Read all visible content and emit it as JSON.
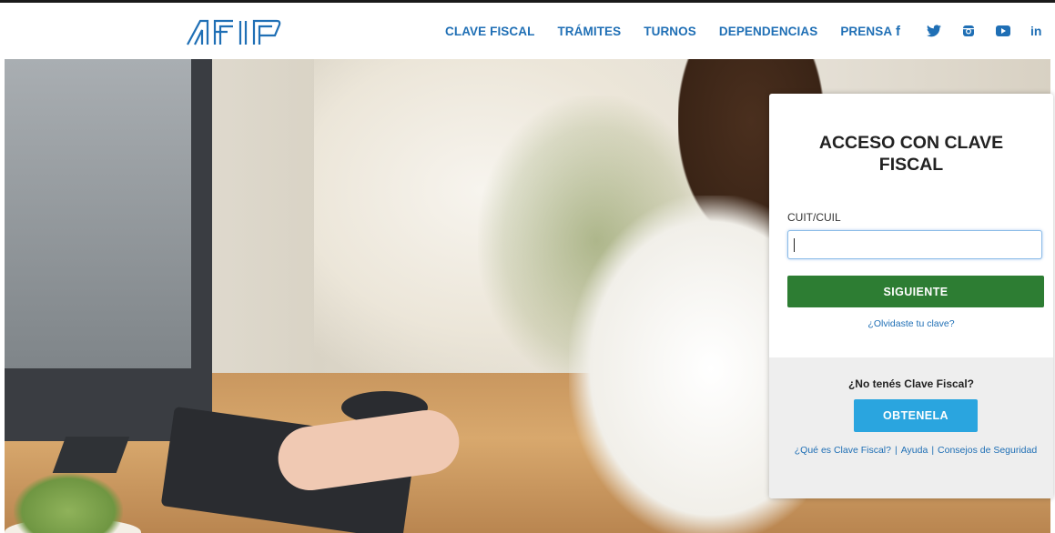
{
  "header": {
    "logo_text": "AFIP",
    "nav": [
      {
        "label": "CLAVE FISCAL"
      },
      {
        "label": "TRÁMITES"
      },
      {
        "label": "TURNOS"
      },
      {
        "label": "DEPENDENCIAS"
      },
      {
        "label": "PRENSA"
      }
    ],
    "social": [
      "facebook-icon",
      "twitter-icon",
      "instagram-icon",
      "youtube-icon",
      "linkedin-icon"
    ],
    "social_text": {
      "facebook": "f",
      "linkedin": "in"
    }
  },
  "login": {
    "title": "ACCESO CON CLAVE FISCAL",
    "cuit_label": "CUIT/CUIL",
    "cuit_value": "",
    "next_button": "SIGUIENTE",
    "forgot_link": "¿Olvidaste tu clave?",
    "no_clave": "¿No tenés Clave Fiscal?",
    "get_button": "OBTENELA",
    "links": {
      "what_is": "¿Qué es Clave Fiscal?",
      "separator": "|",
      "help": "Ayuda",
      "security": "Consejos de Seguridad"
    }
  },
  "colors": {
    "link_blue": "#1f6fb5",
    "green_button": "#2d7d33",
    "cyan_button": "#2aa5df"
  }
}
